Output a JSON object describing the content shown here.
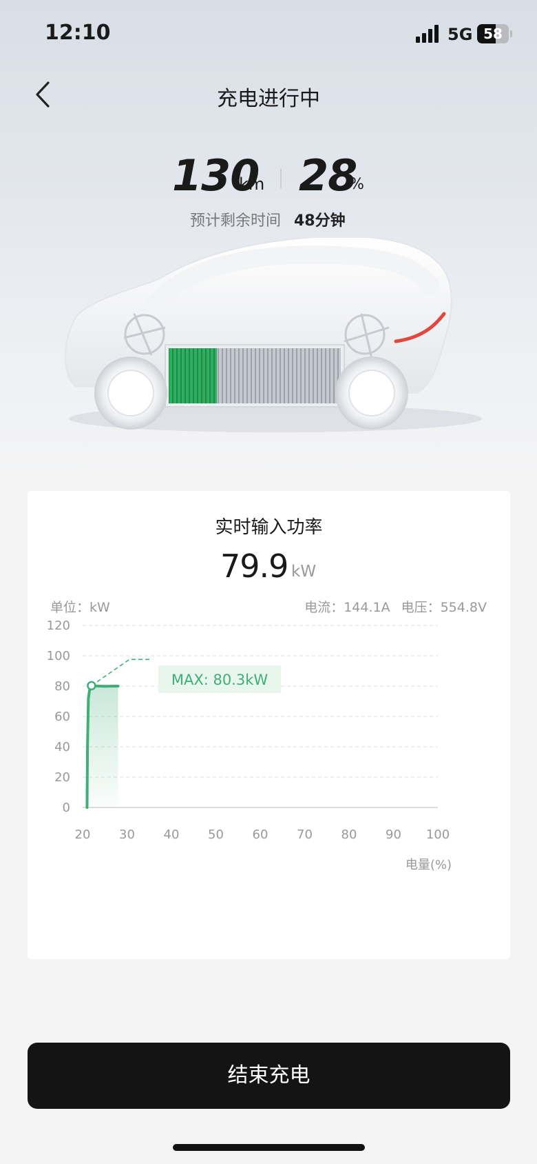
{
  "status_bar": {
    "time": "12:10",
    "network": "5G",
    "battery": "58",
    "battery_level": 0.58
  },
  "header": {
    "title": "充电进行中",
    "back_icon": "chevron-left-icon"
  },
  "summary": {
    "range_value": "130",
    "range_unit": "km",
    "soc_value": "28",
    "soc_unit": "%",
    "eta_label": "预计剩余时间",
    "eta_value": "48分钟",
    "battery_charged_fraction": 0.28
  },
  "card": {
    "title": "实时输入功率",
    "power_value": "79.9",
    "power_unit": "kW",
    "unit_label": "单位：kW",
    "current": "电流：144.1A",
    "voltage": "电压：554.8V"
  },
  "chart_data": {
    "type": "line",
    "title": "",
    "xlabel": "电量(%)",
    "ylabel": "",
    "x_ticks": [
      "20",
      "30",
      "40",
      "50",
      "60",
      "70",
      "80",
      "90",
      "100"
    ],
    "y_ticks": [
      "0",
      "20",
      "40",
      "60",
      "80",
      "100",
      "120"
    ],
    "xlim": [
      20,
      100
    ],
    "ylim": [
      0,
      120
    ],
    "grid": true,
    "series": [
      {
        "x": [
          21,
          21.1,
          21.3,
          21.6,
          22,
          23,
          25,
          27,
          28
        ],
        "y": [
          0,
          40,
          72,
          78,
          80.3,
          80.1,
          79.9,
          80,
          80
        ],
        "color": "#3fae77"
      }
    ],
    "max_point": {
      "x": 22,
      "y": 80.3
    },
    "annotation": "MAX: 80.3kW"
  },
  "actions": {
    "end_charge": "结束充电"
  },
  "colors": {
    "accent_green": "#3fae77",
    "button_bg": "#141414",
    "cable_red": "#e0483e"
  }
}
